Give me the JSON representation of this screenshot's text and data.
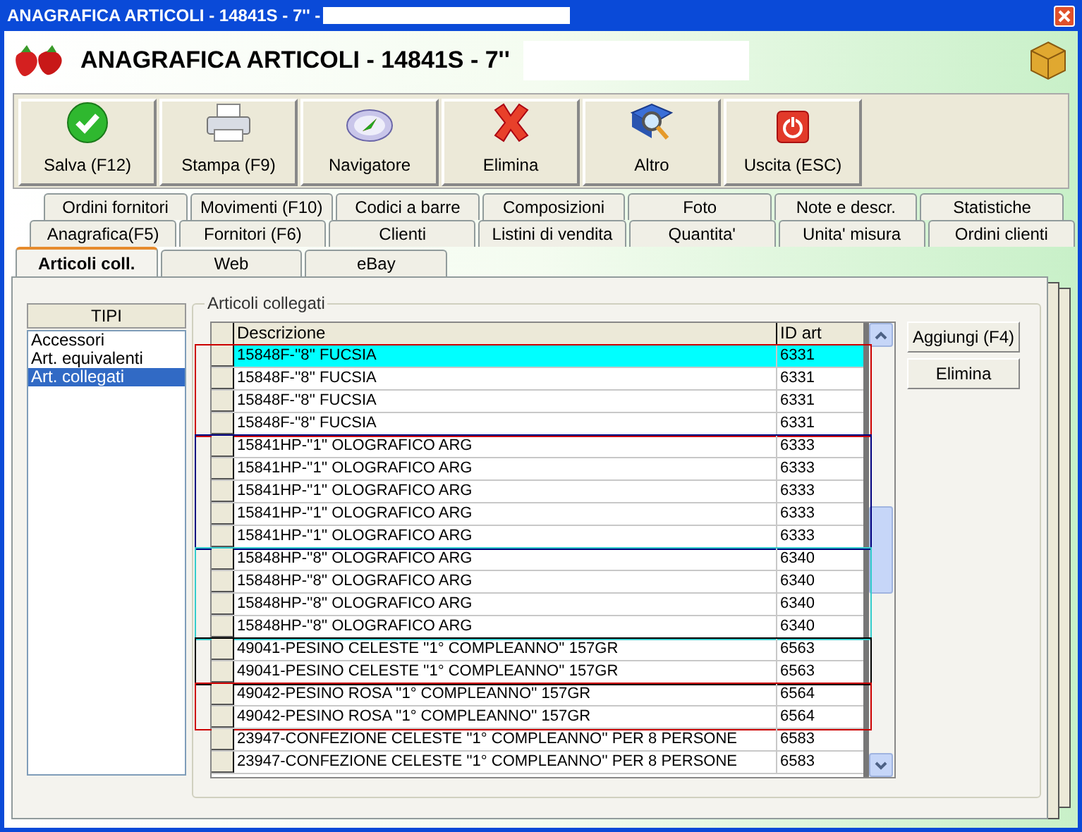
{
  "window": {
    "title": "ANAGRAFICA ARTICOLI - 14841S - 7'' -"
  },
  "header": {
    "title": "ANAGRAFICA ARTICOLI - 14841S - 7''"
  },
  "toolbar": [
    {
      "kind": "save",
      "label": "Salva (F12)"
    },
    {
      "kind": "print",
      "label": "Stampa (F9)"
    },
    {
      "kind": "navigator",
      "label": "Navigatore"
    },
    {
      "kind": "delete",
      "label": "Elimina"
    },
    {
      "kind": "more",
      "label": "Altro"
    },
    {
      "kind": "exit",
      "label": "Uscita (ESC)"
    }
  ],
  "tab_rows": [
    [
      {
        "label": "Ordini fornitori",
        "selected": false
      },
      {
        "label": "Movimenti (F10)",
        "selected": false
      },
      {
        "label": "Codici a barre",
        "selected": false
      },
      {
        "label": "Composizioni",
        "selected": false
      },
      {
        "label": "Foto",
        "selected": false
      },
      {
        "label": "Note e descr.",
        "selected": false
      },
      {
        "label": "Statistiche",
        "selected": false
      }
    ],
    [
      {
        "label": "Anagrafica(F5)",
        "selected": false
      },
      {
        "label": "Fornitori (F6)",
        "selected": false
      },
      {
        "label": "Clienti",
        "selected": false
      },
      {
        "label": "Listini di vendita",
        "selected": false
      },
      {
        "label": "Quantita'",
        "selected": false
      },
      {
        "label": "Unita' misura",
        "selected": false
      },
      {
        "label": "Ordini clienti",
        "selected": false
      }
    ],
    [
      {
        "label": "Articoli coll.",
        "selected": true
      },
      {
        "label": "Web",
        "selected": false
      },
      {
        "label": "eBay",
        "selected": false
      }
    ]
  ],
  "types": {
    "heading": "TIPI",
    "items": [
      {
        "label": "Accessori",
        "selected": false
      },
      {
        "label": "Art. equivalenti",
        "selected": false
      },
      {
        "label": "Art. collegati",
        "selected": true
      }
    ]
  },
  "linked": {
    "legend": "Articoli collegati",
    "columns": [
      "Descrizione",
      "ID art"
    ],
    "row_groups": [
      {
        "color": "#cc0000",
        "rows": [
          {
            "description": "15848F-''8'' FUCSIA",
            "id": "6331",
            "selected": true
          },
          {
            "description": "15848F-''8'' FUCSIA",
            "id": "6331",
            "selected": false
          },
          {
            "description": "15848F-''8'' FUCSIA",
            "id": "6331",
            "selected": false
          },
          {
            "description": "15848F-''8'' FUCSIA",
            "id": "6331",
            "selected": false
          }
        ]
      },
      {
        "color": "#000080",
        "rows": [
          {
            "description": "15841HP-''1'' OLOGRAFICO ARG",
            "id": "6333",
            "selected": false
          },
          {
            "description": "15841HP-''1'' OLOGRAFICO ARG",
            "id": "6333",
            "selected": false
          },
          {
            "description": "15841HP-''1'' OLOGRAFICO ARG",
            "id": "6333",
            "selected": false
          },
          {
            "description": "15841HP-''1'' OLOGRAFICO ARG",
            "id": "6333",
            "selected": false
          },
          {
            "description": "15841HP-''1'' OLOGRAFICO ARG",
            "id": "6333",
            "selected": false
          }
        ]
      },
      {
        "color": "#33cccc",
        "rows": [
          {
            "description": "15848HP-''8'' OLOGRAFICO ARG",
            "id": "6340",
            "selected": false
          },
          {
            "description": "15848HP-''8'' OLOGRAFICO ARG",
            "id": "6340",
            "selected": false
          },
          {
            "description": "15848HP-''8'' OLOGRAFICO ARG",
            "id": "6340",
            "selected": false
          },
          {
            "description": "15848HP-''8'' OLOGRAFICO ARG",
            "id": "6340",
            "selected": false
          }
        ]
      },
      {
        "color": "#000000",
        "rows": [
          {
            "description": "49041-PESINO CELESTE ''1° COMPLEANNO'' 157GR",
            "id": "6563",
            "selected": false
          },
          {
            "description": "49041-PESINO CELESTE ''1° COMPLEANNO'' 157GR",
            "id": "6563",
            "selected": false
          }
        ]
      },
      {
        "color": "#cc0000",
        "rows": [
          {
            "description": "49042-PESINO ROSA ''1° COMPLEANNO'' 157GR",
            "id": "6564",
            "selected": false
          },
          {
            "description": "49042-PESINO ROSA ''1° COMPLEANNO'' 157GR",
            "id": "6564",
            "selected": false
          }
        ]
      },
      {
        "rows": [
          {
            "description": "23947-CONFEZIONE CELESTE ''1° COMPLEANNO'' PER 8 PERSONE",
            "id": "6583",
            "selected": false
          },
          {
            "description": "23947-CONFEZIONE CELESTE ''1° COMPLEANNO'' PER 8 PERSONE",
            "id": "6583",
            "selected": false
          }
        ]
      }
    ],
    "buttons": [
      "Aggiungi (F4)",
      "Elimina"
    ]
  }
}
